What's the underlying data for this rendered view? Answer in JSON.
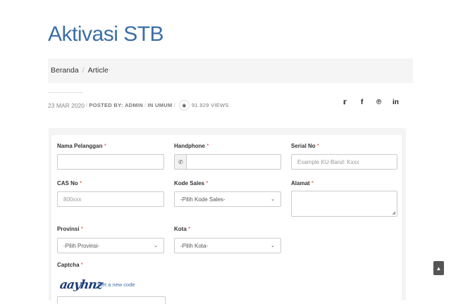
{
  "page": {
    "title": "Aktivasi STB"
  },
  "breadcrumb": {
    "home": "Beranda",
    "separator": "/",
    "current": "Article"
  },
  "meta": {
    "date": "23 MAR 2020",
    "posted_by_label": "POSTED BY:",
    "author": "ADMIN",
    "in_label": "IN",
    "category": "UMUM",
    "views": "91.929 VIEWS"
  },
  "social": {
    "twitter": "twitter-icon",
    "facebook": "facebook-icon",
    "pinterest": "pinterest-icon",
    "linkedin": "linkedin-icon"
  },
  "form": {
    "required_mark": "*",
    "nama_pelanggan": {
      "label": "Nama Pelanggan",
      "value": ""
    },
    "handphone": {
      "label": "Handphone",
      "value": "",
      "addon_icon": "phone-icon"
    },
    "serial_no": {
      "label": "Serial No",
      "placeholder": "Example KU-Band: Kxxx"
    },
    "cas_no": {
      "label": "CAS No",
      "placeholder": "800xxx"
    },
    "kode_sales": {
      "label": "Kode Sales",
      "selected": "-Pilih Kode Sales-"
    },
    "alamat": {
      "label": "Alamat",
      "value": ""
    },
    "provinsi": {
      "label": "Provinsi",
      "selected": "-Pilih Provinsi-"
    },
    "kota": {
      "label": "Kota",
      "selected": "-Pilih Kota-"
    },
    "captcha": {
      "label": "Captcha",
      "image_text": "aayhnz",
      "new_code_link": "Get a new code"
    }
  },
  "colors": {
    "title": "#3b6fa6",
    "required": "#e74c3c",
    "link": "#3b6fa6"
  }
}
